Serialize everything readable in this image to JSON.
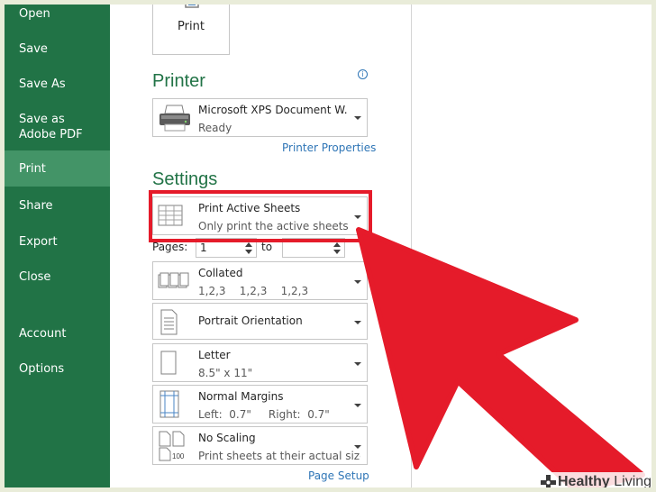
{
  "sidebar": {
    "items": [
      {
        "label": "Open"
      },
      {
        "label": "Save"
      },
      {
        "label": "Save As"
      },
      {
        "label": "Save as Adobe PDF"
      },
      {
        "label": "Print",
        "active": true
      },
      {
        "label": "Share"
      },
      {
        "label": "Export"
      },
      {
        "label": "Close"
      },
      {
        "label": "Account"
      },
      {
        "label": "Options"
      }
    ]
  },
  "print_button": {
    "label": "Print",
    "icon": "printer-icon"
  },
  "printer": {
    "section_title": "Printer",
    "info_icon_glyph": "i",
    "name": "Microsoft XPS Document W...",
    "status": "Ready",
    "properties_link": "Printer Properties"
  },
  "settings": {
    "section_title": "Settings",
    "sheets": {
      "title": "Print Active Sheets",
      "subtitle": "Only print the active sheets"
    },
    "pages": {
      "label": "Pages:",
      "from": "1",
      "to_label": "to",
      "to": ""
    },
    "collation": {
      "title": "Collated",
      "subtitle": "1,2,3    1,2,3    1,2,3"
    },
    "orientation": {
      "title": "Portrait Orientation"
    },
    "paper": {
      "title": "Letter",
      "subtitle": "8.5\" x 11\""
    },
    "margins": {
      "title": "Normal Margins",
      "subtitle": "Left:  0.7\"     Right:  0.7\""
    },
    "scaling": {
      "title": "No Scaling",
      "subtitle": "Print sheets at their actual size",
      "icon_text": "100"
    },
    "page_setup_link": "Page Setup"
  },
  "annotation": {
    "highlight_color": "#e51b2a",
    "arrow_color": "#e51b2a"
  },
  "watermark": {
    "brand_bold": "Healthy",
    "brand_rest": " Living"
  },
  "colors": {
    "sidebar": "#217346",
    "sidebar_active": "#439467",
    "accent_green": "#217346",
    "link_blue": "#2e75b6"
  }
}
